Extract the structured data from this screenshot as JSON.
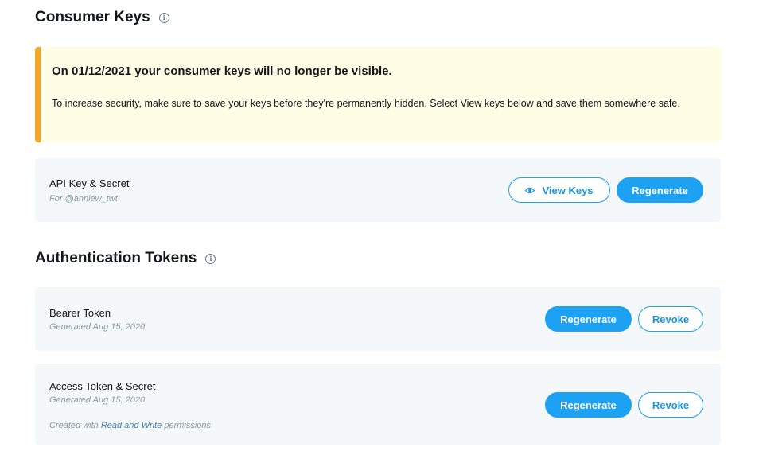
{
  "consumer_keys": {
    "title": "Consumer Keys",
    "info_icon": "i",
    "alert": {
      "title": "On 01/12/2021 your consumer keys will no longer be visible.",
      "body": "To increase security, make sure to save your keys before they're permanently hidden. Select View keys below and save them somewhere safe.",
      "accent_color": "#f5a623"
    },
    "api_card": {
      "title": "API Key & Secret",
      "subtitle": "For @anniew_twt",
      "view_keys_label": "View Keys",
      "view_keys_icon": "eye-icon",
      "regenerate_label": "Regenerate"
    }
  },
  "auth_tokens": {
    "title": "Authentication Tokens",
    "info_icon": "i",
    "bearer_card": {
      "title": "Bearer Token",
      "subtitle": "Generated Aug 15, 2020",
      "regenerate_label": "Regenerate",
      "revoke_label": "Revoke"
    },
    "access_card": {
      "title": "Access Token & Secret",
      "subtitle": "Generated Aug 15, 2020",
      "note_prefix": "Created with",
      "note_link": "Read and Write",
      "note_suffix": "permissions",
      "regenerate_label": "Regenerate",
      "revoke_label": "Revoke"
    }
  },
  "colors": {
    "primary": "#1da1f2",
    "alert_bg": "#fffde5",
    "card_bg": "#f5f8fa"
  }
}
